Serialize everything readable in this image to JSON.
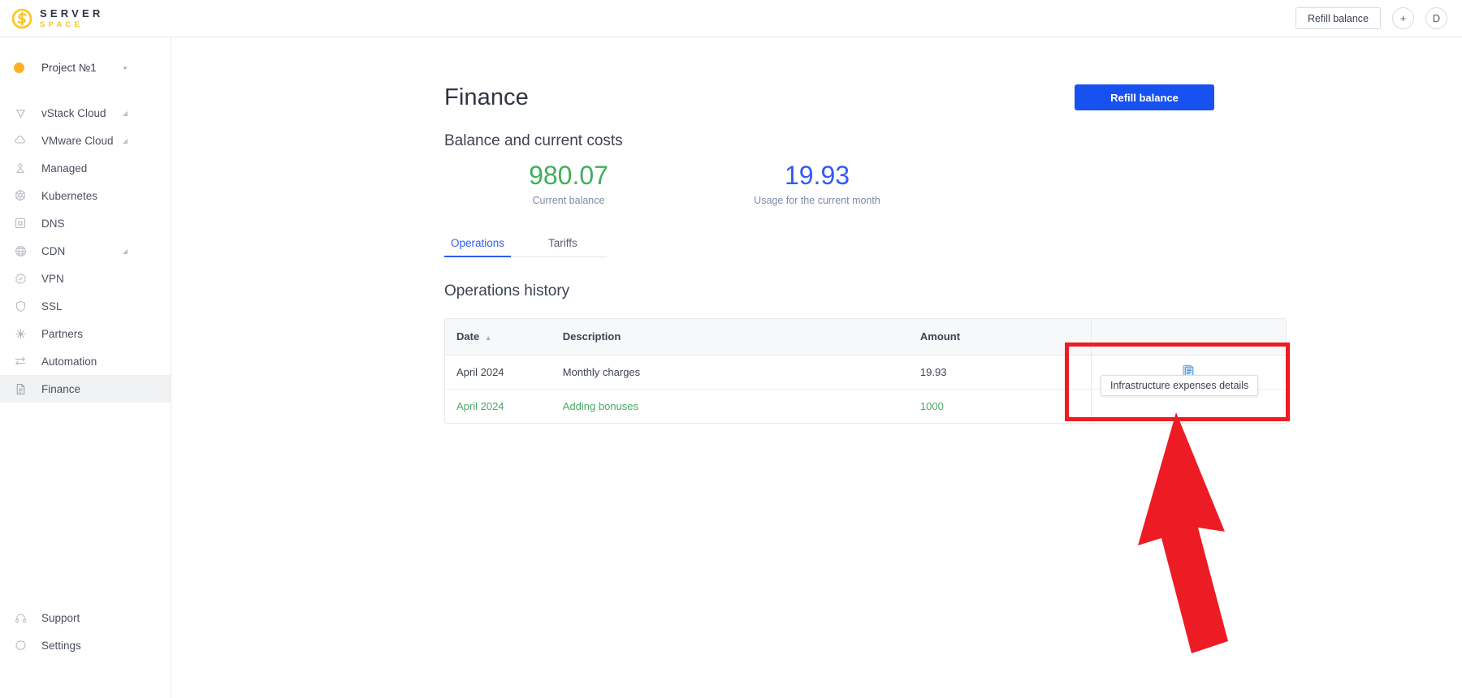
{
  "topbar": {
    "logo": {
      "line1": "SERVER",
      "line2": "SPACE",
      "icon": "serverspace-logo-icon"
    },
    "refill_label": "Refill balance",
    "add_label": "+",
    "avatar_label": "D"
  },
  "sidebar": {
    "project": {
      "label": "Project №1",
      "caret": "▸"
    },
    "items": [
      {
        "label": "vStack Cloud",
        "icon": "vstack-icon",
        "expandable": true,
        "active": false
      },
      {
        "label": "VMware Cloud",
        "icon": "cloud-icon",
        "expandable": true,
        "active": false
      },
      {
        "label": "Managed",
        "icon": "managed-icon",
        "expandable": false,
        "active": false
      },
      {
        "label": "Kubernetes",
        "icon": "kubernetes-icon",
        "expandable": false,
        "active": false
      },
      {
        "label": "DNS",
        "icon": "dns-icon",
        "expandable": false,
        "active": false
      },
      {
        "label": "CDN",
        "icon": "cdn-globe-icon",
        "expandable": true,
        "active": false
      },
      {
        "label": "VPN",
        "icon": "vpn-badge-icon",
        "expandable": false,
        "active": false
      },
      {
        "label": "SSL",
        "icon": "shield-icon",
        "expandable": false,
        "active": false
      },
      {
        "label": "Partners",
        "icon": "partners-icon",
        "expandable": false,
        "active": false
      },
      {
        "label": "Automation",
        "icon": "automation-icon",
        "expandable": false,
        "active": false
      },
      {
        "label": "Finance",
        "icon": "document-icon",
        "expandable": false,
        "active": true
      }
    ],
    "bottom_items": [
      {
        "label": "Support",
        "icon": "headset-icon"
      },
      {
        "label": "Settings",
        "icon": "gear-icon"
      }
    ]
  },
  "main": {
    "page_title": "Finance",
    "refill_button": "Refill balance",
    "balance_section_title": "Balance and current costs",
    "stats": [
      {
        "value": "980.07",
        "caption": "Current balance",
        "color": "#3faf5b"
      },
      {
        "value": "19.93",
        "caption": "Usage for the current month",
        "color": "#2f5cf5"
      }
    ],
    "tabs": [
      {
        "label": "Operations",
        "active": true
      },
      {
        "label": "Tariffs",
        "active": false
      }
    ],
    "history_title": "Operations history",
    "table": {
      "columns": [
        {
          "label": "Date",
          "sort": "▴"
        },
        {
          "label": "Description"
        },
        {
          "label": "Amount"
        },
        {
          "label": ""
        }
      ],
      "rows": [
        {
          "date": "April 2024",
          "description": "Monthly charges",
          "amount": "19.93",
          "action_icon": "invoice-details-icon",
          "green": false
        },
        {
          "date": "April 2024",
          "description": "Adding bonuses",
          "amount": "1000",
          "action_icon": "",
          "green": true
        }
      ]
    },
    "tooltip": "Infrastructure expenses details"
  },
  "annotations": {
    "highlight_color": "#ed1c24",
    "arrow_color": "#ed1c24"
  }
}
